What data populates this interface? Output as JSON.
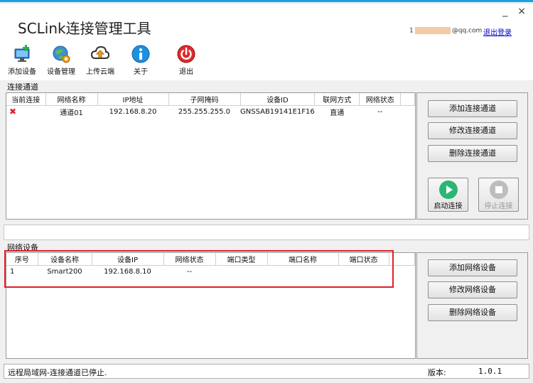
{
  "app": {
    "title": "SCLink连接管理工具",
    "minimize": "_",
    "close": "×",
    "user_email_prefix": "1",
    "user_email_suffix": "@qq.com",
    "logout": "退出登录"
  },
  "toolbar": {
    "items": [
      {
        "label": "添加设备",
        "icon": "add-device-icon"
      },
      {
        "label": "设备管理",
        "icon": "device-manage-icon"
      },
      {
        "label": "上传云端",
        "icon": "cloud-upload-icon"
      },
      {
        "label": "关于",
        "icon": "info-icon"
      },
      {
        "label": "退出",
        "icon": "power-icon"
      }
    ]
  },
  "connections": {
    "section_label": "连接通道",
    "columns": [
      "当前连接",
      "网络名称",
      "IP地址",
      "子网掩码",
      "设备ID",
      "联网方式",
      "网络状态"
    ],
    "rows": [
      {
        "current": "✖",
        "name": "通道01",
        "ip": "192.168.8.20",
        "mask": "255.255.255.0",
        "device_id": "GNSSAB19141E1F16",
        "mode": "直通",
        "status": "--"
      }
    ],
    "buttons": {
      "add": "添加连接通道",
      "edit": "修改连接通道",
      "delete": "删除连接通道",
      "start": "启动连接",
      "stop": "停止连接"
    }
  },
  "devices": {
    "section_label": "网络设备",
    "columns": [
      "序号",
      "设备名称",
      "设备IP",
      "网络状态",
      "端口类型",
      "端口名称",
      "端口状态"
    ],
    "rows": [
      {
        "index": "1",
        "name": "Smart200",
        "ip": "192.168.8.10",
        "status": "--",
        "port_type": "",
        "port_name": "",
        "port_status": ""
      }
    ],
    "buttons": {
      "add": "添加网络设备",
      "edit": "修改网络设备",
      "delete": "删除网络设备"
    }
  },
  "status": {
    "message": "远程局域网-连接通道已停止.",
    "version_label": "版本:",
    "version": "1.0.1"
  },
  "colors": {
    "accent": "#1ba1e2",
    "highlight": "#e0202a",
    "error_x": "#e02020",
    "start_green": "#2bb673",
    "power_red": "#e02a2a"
  }
}
